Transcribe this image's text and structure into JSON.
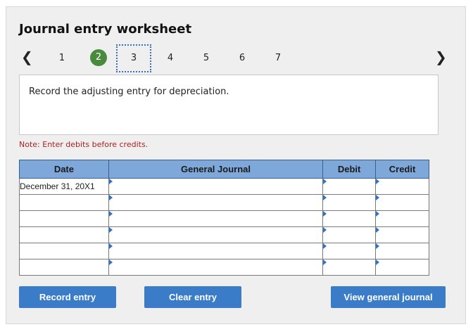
{
  "worksheet": {
    "title": "Journal entry worksheet",
    "pages": [
      "1",
      "2",
      "3",
      "4",
      "5",
      "6",
      "7"
    ],
    "prev_icon": "chevron-left-icon",
    "next_icon": "chevron-right-icon",
    "question": "Record the adjusting entry for depreciation.",
    "note": "Note: Enter debits before credits."
  },
  "table": {
    "headers": {
      "date": "Date",
      "general_journal": "General Journal",
      "debit": "Debit",
      "credit": "Credit"
    },
    "rows": [
      {
        "date": "December 31, 20X1",
        "account": "",
        "debit": "",
        "credit": ""
      },
      {
        "date": "",
        "account": "",
        "debit": "",
        "credit": ""
      },
      {
        "date": "",
        "account": "",
        "debit": "",
        "credit": ""
      },
      {
        "date": "",
        "account": "",
        "debit": "",
        "credit": ""
      },
      {
        "date": "",
        "account": "",
        "debit": "",
        "credit": ""
      },
      {
        "date": "",
        "account": "",
        "debit": "",
        "credit": ""
      }
    ]
  },
  "buttons": {
    "record": "Record entry",
    "clear": "Clear entry",
    "view": "View general journal"
  },
  "colors": {
    "header_bg": "#7ea8da",
    "button_bg": "#3a7cc7",
    "completed_page": "#4a8a3f",
    "note_text": "#b02020"
  }
}
